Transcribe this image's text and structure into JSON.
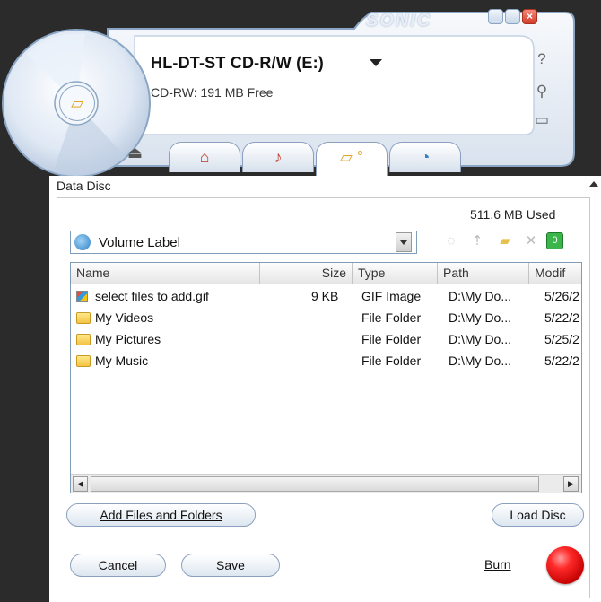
{
  "window": {
    "brand": "SONIC",
    "drive": "HL-DT-ST CD-R/W (E:)",
    "disc_info": "CD-RW: 191 MB Free"
  },
  "panel": {
    "title": "Data Disc",
    "used": "511.6 MB Used",
    "volume_label": "Volume Label"
  },
  "columns": [
    "Name",
    "Size",
    "Type",
    "Path",
    "Modif"
  ],
  "files": [
    {
      "name": "select files to add.gif",
      "size": "9 KB",
      "type": "GIF Image",
      "path": "D:\\My Do...",
      "modified": "5/26/2",
      "icon": "gif-file-icon"
    },
    {
      "name": "My Videos",
      "size": "",
      "type": "File Folder",
      "path": "D:\\My Do...",
      "modified": "5/22/2",
      "icon": "folder-icon"
    },
    {
      "name": "My Pictures",
      "size": "",
      "type": "File Folder",
      "path": "D:\\My Do...",
      "modified": "5/25/2",
      "icon": "folder-icon"
    },
    {
      "name": "My Music",
      "size": "",
      "type": "File Folder",
      "path": "D:\\My Do...",
      "modified": "5/22/2",
      "icon": "folder-icon"
    }
  ],
  "buttons": {
    "add": "Add Files and Folders",
    "load": "Load Disc",
    "cancel": "Cancel",
    "save": "Save",
    "burn": "Burn"
  },
  "colors": {
    "burn": "#ff2a2a",
    "skin_blue": "#8aa6c4",
    "close": "#e04a3a"
  }
}
